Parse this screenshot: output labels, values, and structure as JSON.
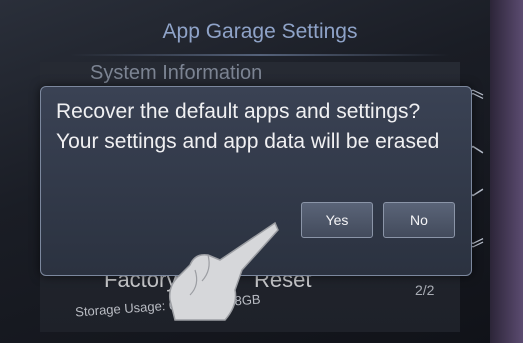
{
  "header": {
    "title": "App Garage Settings"
  },
  "list": {
    "first_row": "System Information",
    "factory_label": "Factory",
    "reset_label": "Reset",
    "storage_text": "Storage Usage: 0.09GB/0.98GB",
    "page_indicator": "2/2"
  },
  "dialog": {
    "message": "Recover the default apps and settings? Your settings and app data will be erased",
    "yes_label": "Yes",
    "no_label": "No"
  },
  "icons": {
    "scroll_top": "double-chevron-up-icon",
    "scroll_up": "chevron-up-icon",
    "scroll_down": "chevron-down-icon",
    "scroll_bottom": "double-chevron-down-icon",
    "pointer": "hand-pointer-icon"
  }
}
